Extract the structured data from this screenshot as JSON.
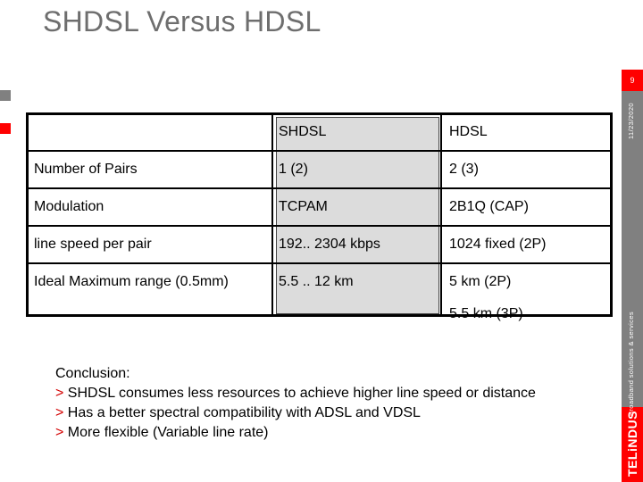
{
  "slide": {
    "title": "SHDSL Versus HDSL",
    "page_number": "9",
    "date": "11/23/2020",
    "side_tag": "Broadband solutions & services",
    "logo_text": "TELiNDUS"
  },
  "table": {
    "headers": [
      "",
      "SHDSL",
      "HDSL"
    ],
    "rows": [
      {
        "label": "Number of Pairs",
        "shdsl": "1 (2)",
        "hdsl": "2 (3)"
      },
      {
        "label": "Modulation",
        "shdsl": "TCPAM",
        "hdsl": "2B1Q (CAP)"
      },
      {
        "label": "line speed per pair",
        "shdsl": "192.. 2304 kbps",
        "hdsl": "1024 fixed (2P)"
      },
      {
        "label": "Ideal Maximum range (0.5mm)",
        "shdsl": "5.5 .. 12 km",
        "hdsl": "5 km (2P)",
        "hdsl_extra": "5.5 km (3P)"
      }
    ]
  },
  "conclusion": {
    "heading": "Conclusion:",
    "bullet_marker": ">",
    "bullets": [
      "SHDSL consumes less resources to achieve higher line speed or distance",
      "Has a better spectral compatibility with ADSL and VDSL",
      "More flexible (Variable line rate)"
    ]
  },
  "colors": {
    "accent_red": "#ff0000",
    "sidebar_gray": "#808080",
    "shdsl_column_fill": "#dcdcdc",
    "title_gray": "#6e6e6e"
  }
}
